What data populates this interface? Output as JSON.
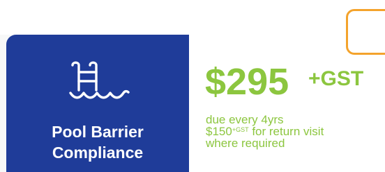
{
  "service": {
    "title_line1": "Pool Barrier",
    "title_line2": "Compliance",
    "icon": "pool-ladder-icon"
  },
  "pricing": {
    "amount": "$295",
    "amount_suffix": "+GST",
    "line1": "due every 4yrs",
    "line2_amount": "$150",
    "line2_suffix": "+GST",
    "line2_rest": " for return visit",
    "line3": "where required"
  },
  "colors": {
    "tile": "#1f3c99",
    "price": "#8cc63f",
    "accent_outline": "#f4a32c"
  }
}
